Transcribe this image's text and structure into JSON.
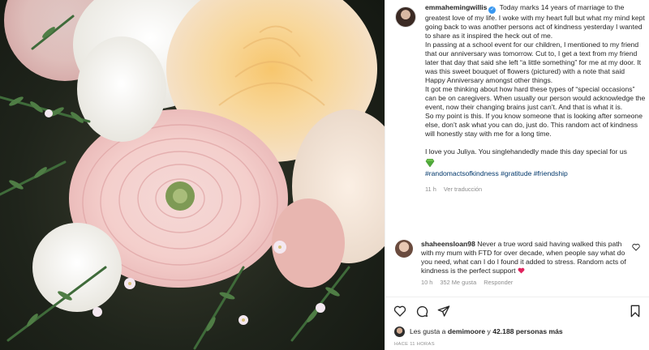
{
  "post": {
    "username": "emmahemingwillis",
    "caption_intro": "Today marks 14 years of marriage to the greatest love of my life. I woke with my heart full but what my mind kept going back to was another persons act of kindness yesterday I wanted to share as it inspired the heck out of me.",
    "caption_p2": "In passing at a school event for our children, I mentioned to my friend that our anniversary was tomorrow. Cut to, I get a text from my friend later that day that said she left “a little something” for me at my door. It was this sweet bouquet of flowers (pictured) with a note that said Happy Anniversary amongst other things.",
    "caption_p3": "It got me thinking about how hard these types of “special occasions” can be on caregivers. When usually our person would acknowledge the event, now their changing brains just can’t. And that is what it is.",
    "caption_p4": "So my point is this. If you know someone that is looking after someone else, don’t ask what you can do, just do. This random act of kindness will honestly stay with me for a long time.",
    "caption_p5": "I love you Juliya. You singlehandedly made this day special for us",
    "hashtags": "#randomactsofkindness #gratitude #friendship",
    "time": "11 h",
    "translate": "Ver traducción"
  },
  "comment": {
    "username": "shaheensloan98",
    "text": "Never a true word said having walked this path with my mum with FTD for over decade, when people say what do you need, what can I do I found it added to stress. Random acts of kindness is the perfect support",
    "time": "10 h",
    "likes": "352 Me gusta",
    "reply": "Responder"
  },
  "likes": {
    "prefix": "Les gusta a",
    "first": "demimoore",
    "connector": "y",
    "others": "42.188 personas más"
  },
  "timestamp": "HACE 11 HORAS",
  "icons": {
    "like": "heart-icon",
    "comment": "comment-icon",
    "share": "paper-plane-icon",
    "save": "bookmark-icon"
  },
  "colors": {
    "hashtag": "#00376b",
    "verified": "#3897f0",
    "muted": "#8e8e8e"
  }
}
